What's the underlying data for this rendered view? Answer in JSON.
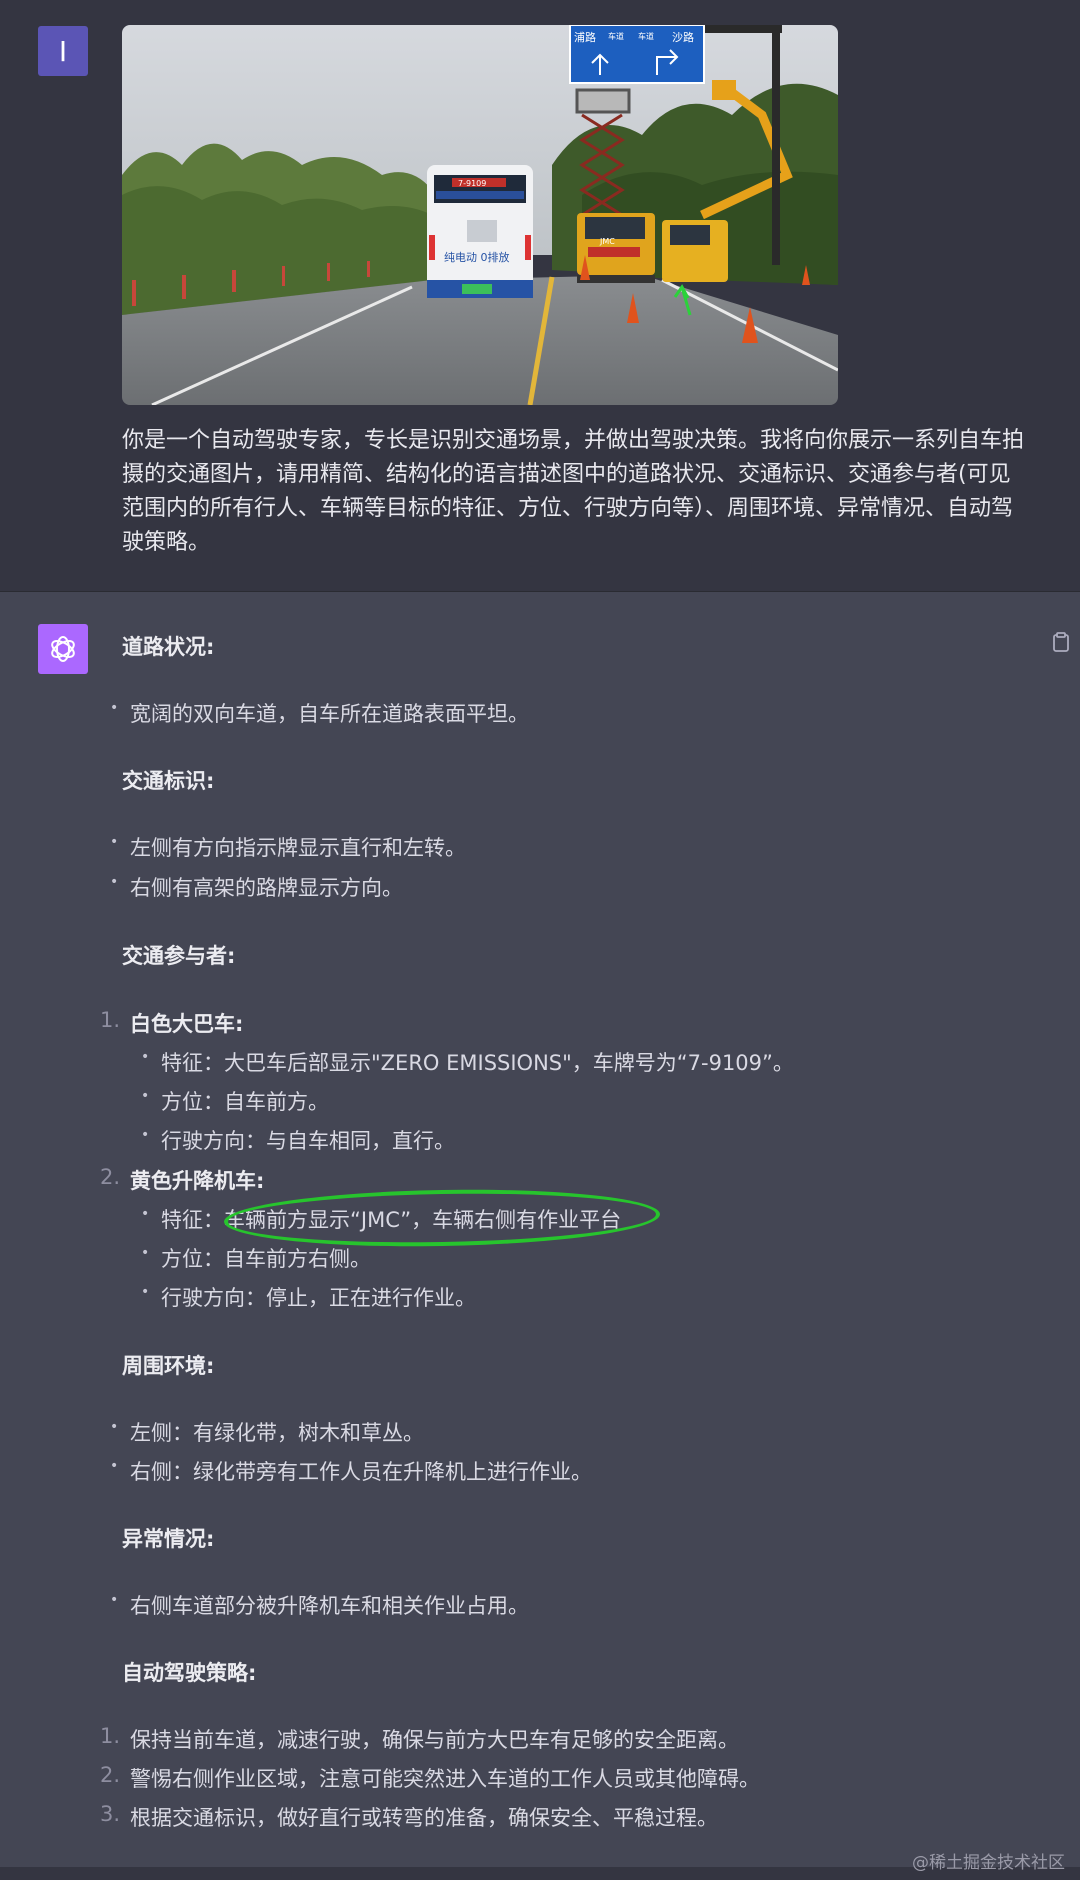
{
  "user": {
    "avatar_letter": "I",
    "sign": {
      "left_text": "浦路",
      "right_text": "沙路",
      "middle_top": "车道",
      "middle_bottom": "车道"
    },
    "bus_text": {
      "display": "7-9109",
      "side": "纯电动 0排放"
    },
    "truck_label": "JMC",
    "prompt": "你是一个自动驾驶专家，专长是识别交通场景，并做出驾驶决策。我将向你展示一系列自车拍摄的交通图片，请用精简、结构化的语言描述图中的道路状况、交通标识、交通参与者(可见范围内的所有行人、车辆等目标的特征、方位、行驶方向等）、周围环境、异常情况、自动驾驶策略。"
  },
  "assistant": {
    "sections": {
      "road": {
        "title": "道路状况:",
        "items": [
          "宽阔的双向车道，自车所在道路表面平坦。"
        ]
      },
      "signs": {
        "title": "交通标识:",
        "items": [
          "左侧有方向指示牌显示直行和左转。",
          "右侧有高架的路牌显示方向。"
        ]
      },
      "participants": {
        "title": "交通参与者:",
        "vehicles": [
          {
            "num": "1.",
            "name": "白色大巴车:",
            "details": [
              "特征：大巴车后部显示\"ZERO EMISSIONS\"，车牌号为“7-9109”。",
              "方位：自车前方。",
              "行驶方向：与自车相同，直行。"
            ]
          },
          {
            "num": "2.",
            "name": "黄色升降机车:",
            "details": [
              "特征：车辆前方显示“JMC”，车辆右侧有作业平台",
              "方位：自车前方右侧。",
              "行驶方向：停止，正在进行作业。"
            ]
          }
        ]
      },
      "environment": {
        "title": "周围环境:",
        "items": [
          "左侧：有绿化带，树木和草丛。",
          "右侧：绿化带旁有工作人员在升降机上进行作业。"
        ]
      },
      "anomaly": {
        "title": "异常情况:",
        "items": [
          "右侧车道部分被升降机车和相关作业占用。"
        ]
      },
      "strategy": {
        "title": "自动驾驶策略:",
        "items": [
          {
            "num": "1.",
            "text": "保持当前车道，减速行驶，确保与前方大巴车有足够的安全距离。"
          },
          {
            "num": "2.",
            "text": "警惕右侧作业区域，注意可能突然进入车道的工作人员或其他障碍。"
          },
          {
            "num": "3.",
            "text": "根据交通标识，做好直行或转弯的准备，确保安全、平稳过程。"
          }
        ]
      }
    }
  },
  "watermark": "@稀土掘金技术社区",
  "colors": {
    "page_bg": "#444654",
    "user_bg": "#343541",
    "user_avatar": "#5b55b5",
    "bot_avatar": "#ab68ff",
    "highlight": "#27c42d"
  }
}
